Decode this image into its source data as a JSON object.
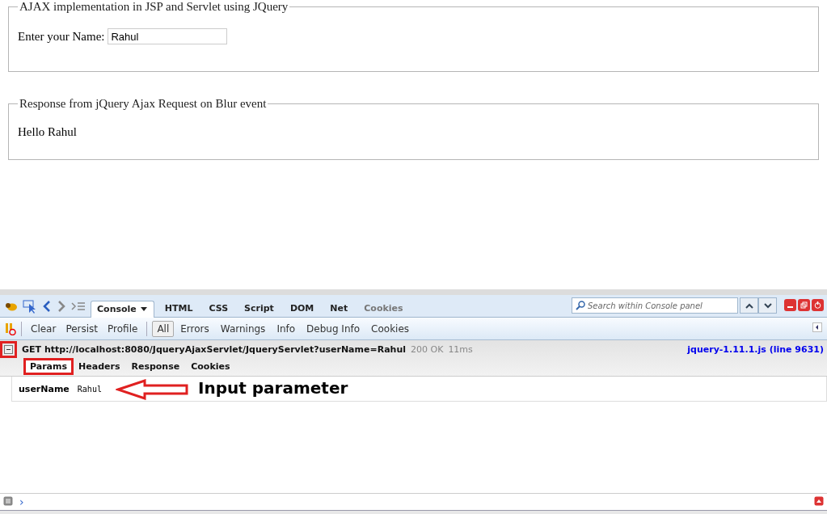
{
  "form": {
    "legend": "AJAX implementation in JSP and Servlet using JQuery",
    "label": "Enter your Name:",
    "value": "Rahul"
  },
  "response": {
    "legend": "Response from jQuery Ajax Request on Blur event",
    "text": "Hello Rahul"
  },
  "firebug": {
    "tabs": [
      {
        "label": "Console",
        "selected": true,
        "disabled": false
      },
      {
        "label": "HTML",
        "selected": false,
        "disabled": false
      },
      {
        "label": "CSS",
        "selected": false,
        "disabled": false
      },
      {
        "label": "Script",
        "selected": false,
        "disabled": false
      },
      {
        "label": "DOM",
        "selected": false,
        "disabled": false
      },
      {
        "label": "Net",
        "selected": false,
        "disabled": false
      },
      {
        "label": "Cookies",
        "selected": false,
        "disabled": true
      }
    ],
    "search": {
      "placeholder": "Search within Console panel"
    },
    "actions": [
      "Clear",
      "Persist",
      "Profile"
    ],
    "filters": [
      {
        "label": "All",
        "selected": true
      },
      {
        "label": "Errors",
        "selected": false
      },
      {
        "label": "Warnings",
        "selected": false
      },
      {
        "label": "Info",
        "selected": false
      },
      {
        "label": "Debug Info",
        "selected": false
      },
      {
        "label": "Cookies",
        "selected": false
      }
    ],
    "request": {
      "expanded": true,
      "annotated": true,
      "text": "GET http://localhost:8080/JqueryAjaxServlet/JqueryServlet?userName=Rahul",
      "status": "200 OK",
      "time": "11ms",
      "source": "jquery-1.11.1.js (line 9631)"
    },
    "subtabs": [
      {
        "label": "Params",
        "selected": true,
        "annotated": true
      },
      {
        "label": "Headers",
        "selected": false,
        "annotated": false
      },
      {
        "label": "Response",
        "selected": false,
        "annotated": false
      },
      {
        "label": "Cookies",
        "selected": false,
        "annotated": false
      }
    ],
    "params": [
      {
        "name": "userName",
        "value": "Rahul"
      }
    ],
    "annotation": "Input parameter",
    "prompt": "›"
  }
}
